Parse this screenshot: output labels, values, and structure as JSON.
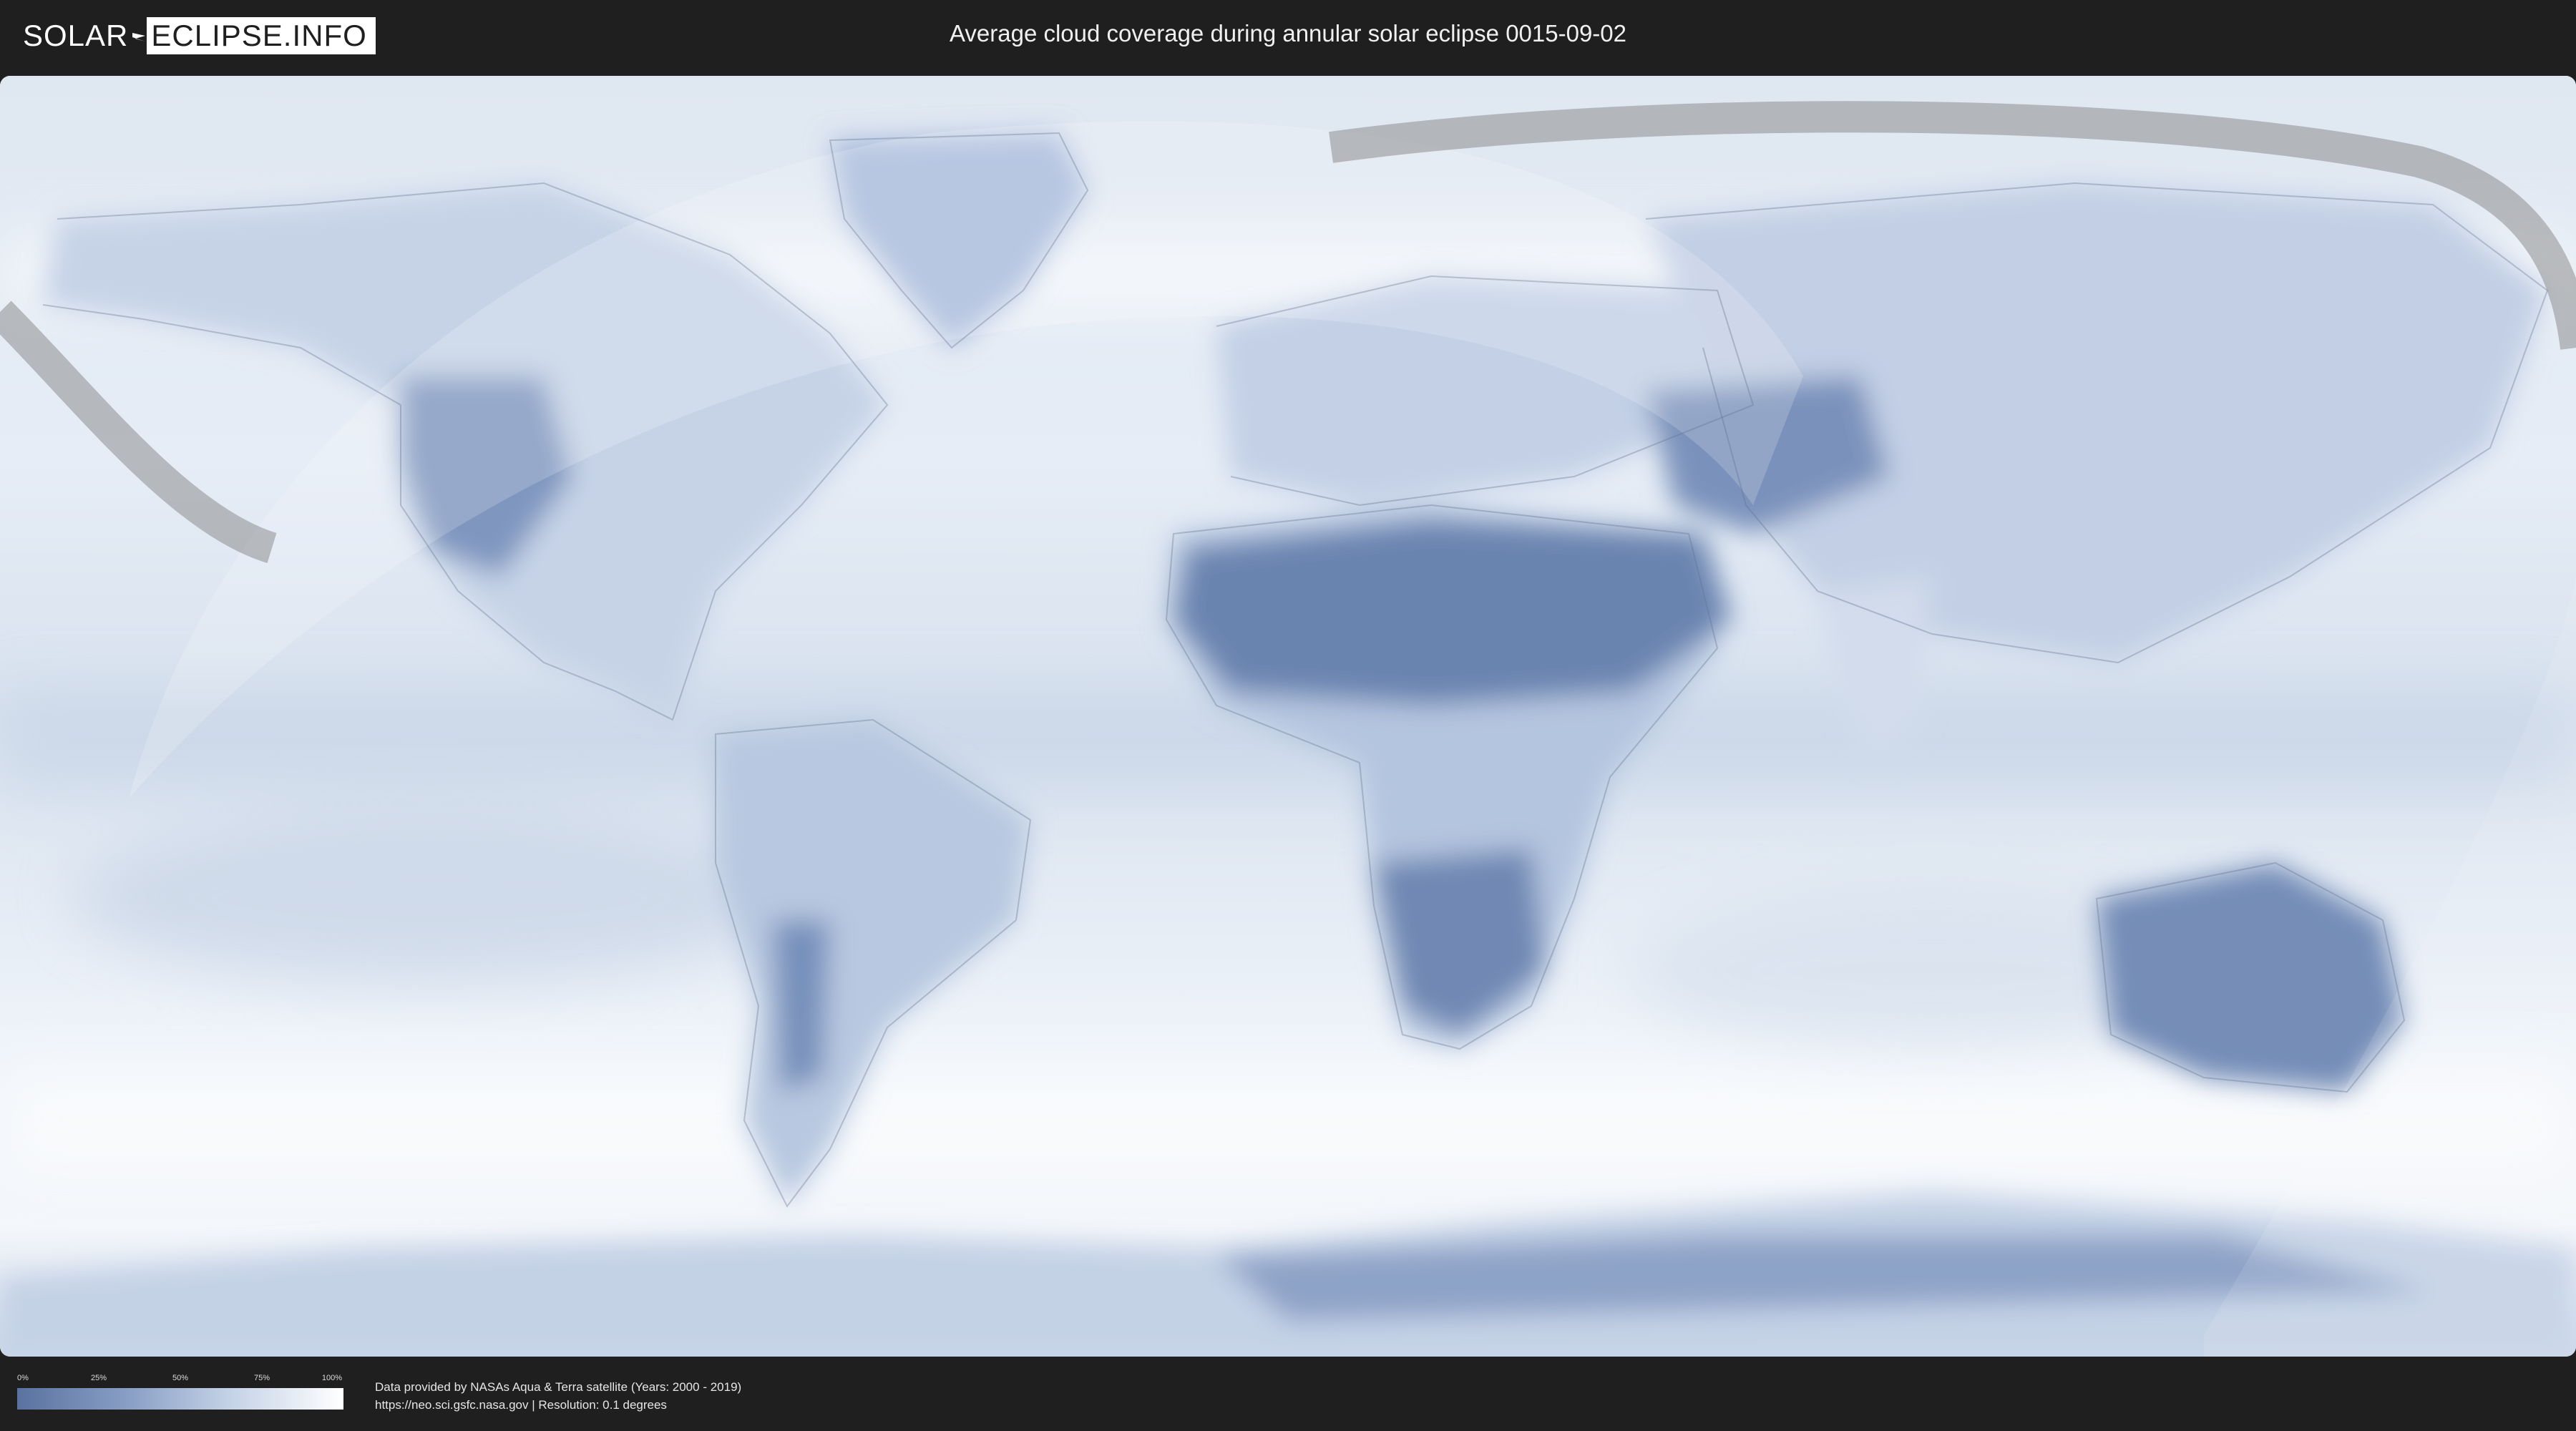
{
  "header": {
    "logo_left": "SOLAR",
    "logo_right": "ECLIPSE.INFO",
    "title": "Average cloud coverage during annular solar eclipse 0015-09-02"
  },
  "legend": {
    "ticks": [
      "0%",
      "25%",
      "50%",
      "75%",
      "100%"
    ],
    "gradient_colors": [
      "#5a72a0",
      "#8aa0c6",
      "#c4d2e6",
      "#ffffff"
    ]
  },
  "footer": {
    "credit_line_1": "Data provided by NASAs Aqua & Terra satellite (Years: 2000 - 2019)",
    "credit_line_2": "https://neo.sci.gsfc.nasa.gov | Resolution: 0.1 degrees"
  },
  "colors": {
    "background": "#1f1f1f",
    "ocean_cloud": "#eaf0f7",
    "clear_land": "#6a84b0",
    "eclipse_path": "#9a9a9a"
  }
}
